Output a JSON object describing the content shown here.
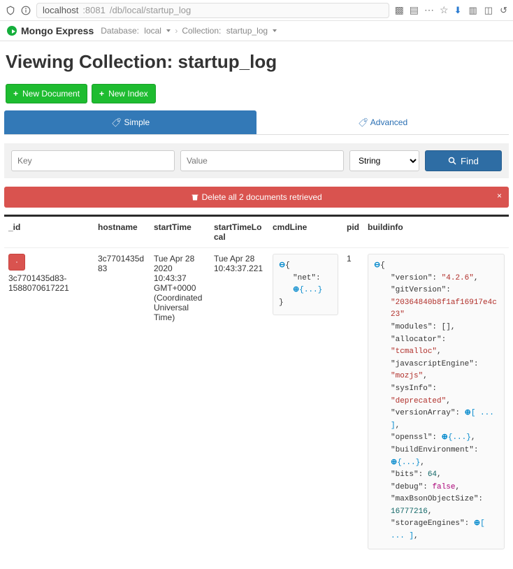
{
  "url": {
    "host": "localhost",
    "port": ":8081",
    "path": "/db/local/startup_log"
  },
  "app_name": "Mongo Express",
  "breadcrumbs": {
    "db_label": "Database:",
    "db_value": "local",
    "coll_label": "Collection:",
    "coll_value": "startup_log"
  },
  "heading": "Viewing Collection: startup_log",
  "buttons": {
    "new_document": "New Document",
    "new_index": "New Index"
  },
  "tabs": {
    "simple": "Simple",
    "advanced": "Advanced"
  },
  "filter": {
    "key_placeholder": "Key",
    "value_placeholder": "Value",
    "type_value": "String",
    "find": "Find"
  },
  "delete_bar": "Delete all 2 documents retrieved",
  "columns": {
    "id": "_id",
    "hostname": "hostname",
    "startTime": "startTime",
    "startTimeLocal": "startTimeLocal",
    "cmdLine": "cmdLine",
    "pid": "pid",
    "buildinfo": "buildinfo"
  },
  "row": {
    "id": "3c7701435d83-1588070617221",
    "hostname": "3c7701435d83",
    "startTime": "Tue Apr 28 2020 10:43:37 GMT+0000 (Coordinated Universal Time)",
    "startTimeLocal": "Tue Apr 28 10:43:37.221",
    "pid": "1",
    "cmdLine_net_key": "net",
    "buildinfo": {
      "version_k": "version",
      "version_v": "4.2.6",
      "git_k": "gitVersion",
      "git_v": "20364840b8f1af16917e4c23",
      "modules_k": "modules",
      "alloc_k": "allocator",
      "alloc_v": "tcmalloc",
      "jse_k": "javascriptEngine",
      "jse_v": "mozjs",
      "sys_k": "sysInfo",
      "sys_v": "deprecated",
      "varr_k": "versionArray",
      "openssl_k": "openssl",
      "benv_k": "buildEnvironment",
      "bits_k": "bits",
      "bits_v": "64",
      "debug_k": "debug",
      "debug_v": "false",
      "mbs_k": "maxBsonObjectSize",
      "mbs_v": "16777216",
      "se_k": "storageEngines"
    }
  },
  "expand_symbol": "⊕",
  "collapse_ell": "{...}",
  "arr_ell": "[ ... ]"
}
